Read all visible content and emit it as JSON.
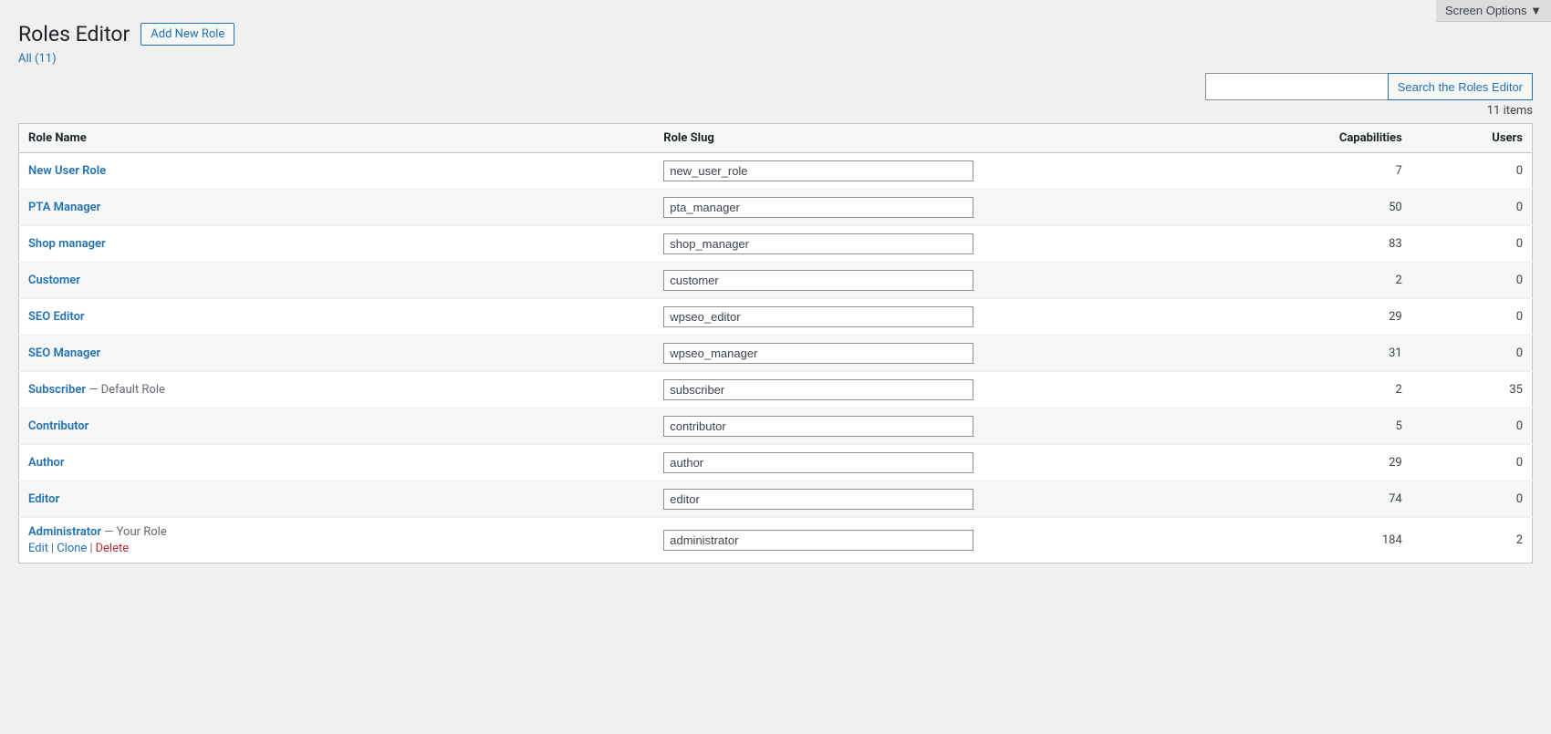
{
  "screenOptions": {
    "label": "Screen Options ▼"
  },
  "header": {
    "title": "Roles Editor",
    "addNewBtn": "Add New Role"
  },
  "filter": {
    "allLabel": "All",
    "allCount": "11"
  },
  "search": {
    "placeholder": "",
    "btnLabel": "Search the Roles Editor"
  },
  "itemsCount": "11 items",
  "table": {
    "columns": {
      "roleName": "Role Name",
      "roleSlug": "Role Slug",
      "capabilities": "Capabilities",
      "users": "Users"
    },
    "rows": [
      {
        "name": "New User Role",
        "tag": "",
        "slug": "new_user_role",
        "capabilities": "7",
        "users": "0"
      },
      {
        "name": "PTA Manager",
        "tag": "",
        "slug": "pta_manager",
        "capabilities": "50",
        "users": "0"
      },
      {
        "name": "Shop manager",
        "tag": "",
        "slug": "shop_manager",
        "capabilities": "83",
        "users": "0"
      },
      {
        "name": "Customer",
        "tag": "",
        "slug": "customer",
        "capabilities": "2",
        "users": "0"
      },
      {
        "name": "SEO Editor",
        "tag": "",
        "slug": "wpseo_editor",
        "capabilities": "29",
        "users": "0"
      },
      {
        "name": "SEO Manager",
        "tag": "",
        "slug": "wpseo_manager",
        "capabilities": "31",
        "users": "0"
      },
      {
        "name": "Subscriber",
        "tag": " — Default Role",
        "slug": "subscriber",
        "capabilities": "2",
        "users": "35"
      },
      {
        "name": "Contributor",
        "tag": "",
        "slug": "contributor",
        "capabilities": "5",
        "users": "0"
      },
      {
        "name": "Author",
        "tag": "",
        "slug": "author",
        "capabilities": "29",
        "users": "0"
      },
      {
        "name": "Editor",
        "tag": "",
        "slug": "editor",
        "capabilities": "74",
        "users": "0"
      },
      {
        "name": "Administrator",
        "tag": " — Your Role",
        "slug": "administrator",
        "capabilities": "184",
        "users": "2"
      }
    ],
    "rowActions": {
      "edit": "Edit",
      "clone": "Clone",
      "delete": "Delete"
    }
  }
}
